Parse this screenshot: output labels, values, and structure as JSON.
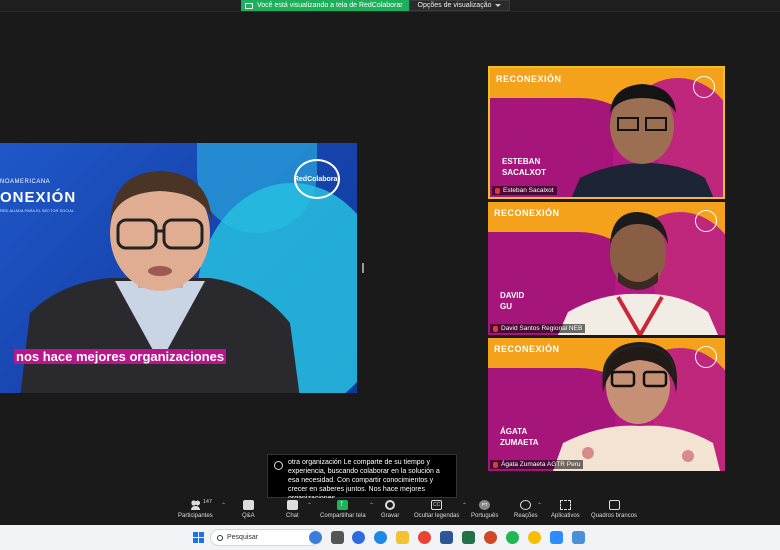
{
  "share_banner": {
    "message": "Você está visualizando a tela de RedColaborar",
    "options_label": "Opções de visualização"
  },
  "main_video": {
    "brand_small": "NOAMERICANA",
    "brand_big": "ONEXIÓN",
    "brand_tag": "RED ALIADA PARA EL SECTOR SOCIAL",
    "logo_text": "RedColaborar",
    "caption_overlay": "nos hace mejores organizaciones"
  },
  "tiles": [
    {
      "overlay_first": "ESTEBAN",
      "overlay_last": "SACALXOT",
      "name_tag": "Esteban Sacalxot",
      "logo_text": "RECONEXIÓN"
    },
    {
      "overlay_first": "DAVID",
      "overlay_last": "GU",
      "name_tag": "David Santos Regional NEB",
      "logo_text": "RECONEXIÓN"
    },
    {
      "overlay_first": "ÁGATA",
      "overlay_last": "ZUMAETA",
      "name_tag": "Ágata Zumaeta AGTR Peru",
      "logo_text": "RECONEXIÓN"
    }
  ],
  "captions": {
    "text": "otra organización Le comparte de su tiempo y experiencia, buscando colaborar en la solución a esa necesidad. Con compartir conocimientos y crecer en saberes juntos. Nos hace mejores organizaciones"
  },
  "toolbar": {
    "participants_label": "Participantes",
    "participants_count": "147",
    "qa_label": "Q&A",
    "chat_label": "Chat",
    "share_label": "Compartilhar tela",
    "record_label": "Gravar",
    "cc_label": "Ocultar legendas",
    "cc_icon": "CC",
    "language_label": "Português",
    "language_icon": "PT",
    "reactions_label": "Reações",
    "apps_label": "Aplicativos",
    "whiteboard_label": "Quadros brancos"
  },
  "taskbar": {
    "search_placeholder": "Pesquisar"
  },
  "colors": {
    "zoom_green": "#1fae5b",
    "reconexion_orange": "#f4a21b",
    "reconexion_magenta": "#a6157a",
    "redcolaborar_blue": "#1e58c8"
  }
}
